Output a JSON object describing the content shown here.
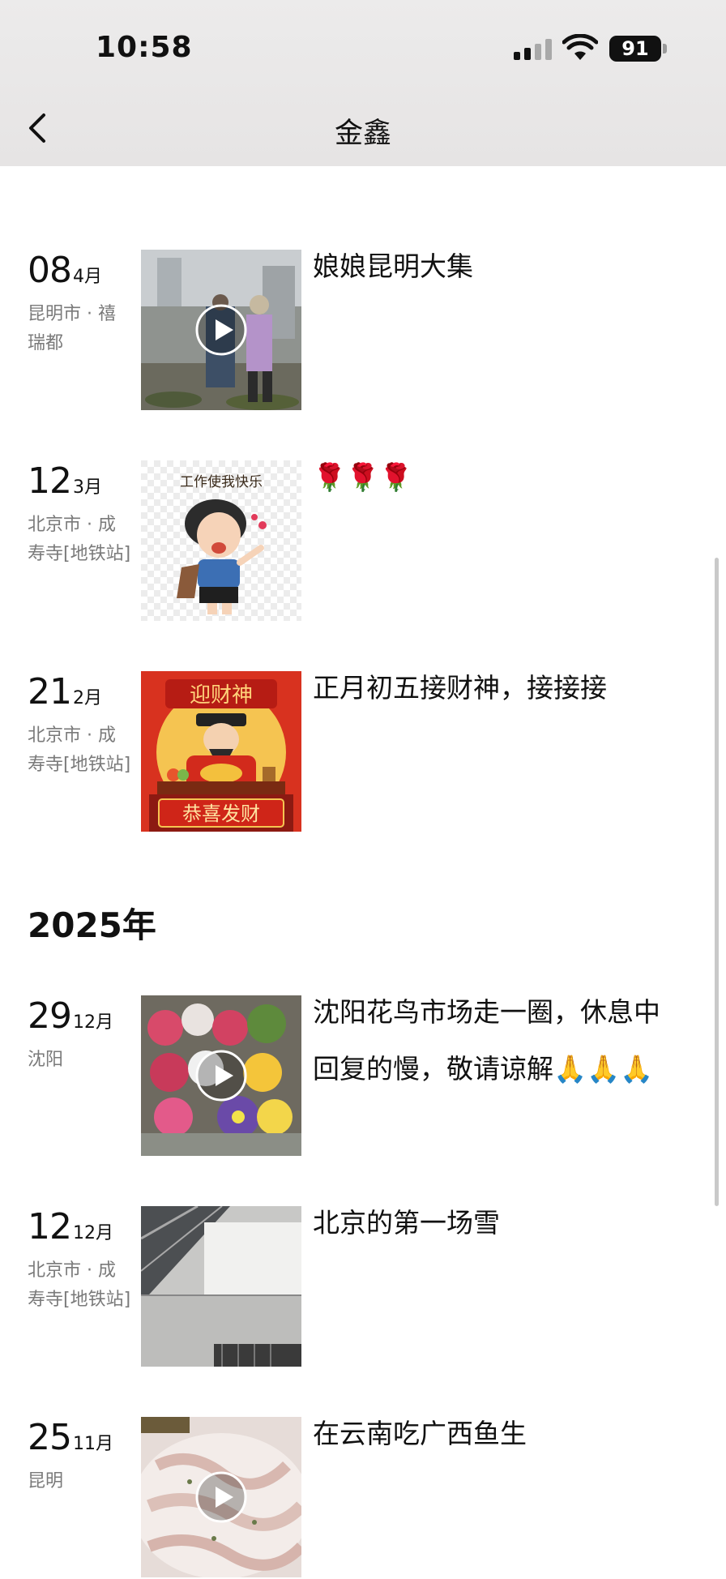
{
  "status_bar": {
    "time": "10:58",
    "battery": "91"
  },
  "nav": {
    "title": "金鑫"
  },
  "posts_2026": [
    {
      "day": "08",
      "month": "4月",
      "location": "昆明市 · 禧瑞都",
      "text": "娘娘昆明大集",
      "media": "video"
    },
    {
      "day": "12",
      "month": "3月",
      "location": "北京市 · 成寿寺[地铁站]",
      "text": "🌹🌹🌹",
      "media": "image",
      "thumb_caption": "工作使我快乐"
    },
    {
      "day": "21",
      "month": "2月",
      "location": "北京市 · 成寿寺[地铁站]",
      "text": "正月初五接财神，接接接",
      "media": "image",
      "thumb_banner_top": "迎财神",
      "thumb_banner_bottom": "恭喜发财"
    }
  ],
  "year_header": "2025年",
  "posts_2025": [
    {
      "day": "29",
      "month": "12月",
      "location": "沈阳",
      "text": "沈阳花鸟市场走一圈，休息中回复的慢，敬请谅解🙏🙏🙏",
      "media": "video"
    },
    {
      "day": "12",
      "month": "12月",
      "location": "北京市 · 成寿寺[地铁站]",
      "text": "北京的第一场雪",
      "media": "image"
    },
    {
      "day": "25",
      "month": "11月",
      "location": "昆明",
      "text": "在云南吃广西鱼生",
      "media": "video"
    }
  ],
  "colors": {
    "header_bg": "#e8e6e6",
    "secondary_text": "#7a7a7a"
  }
}
